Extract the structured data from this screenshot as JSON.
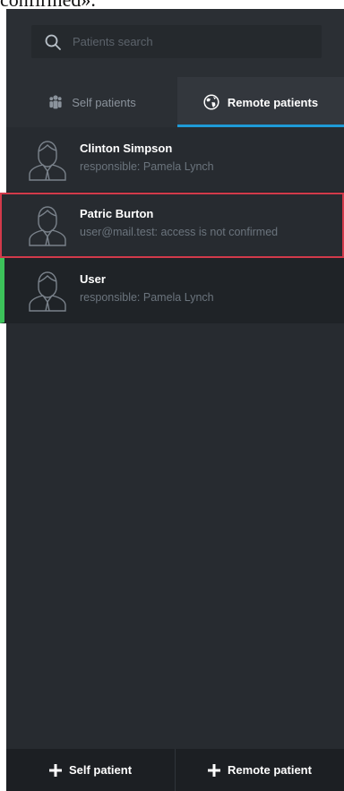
{
  "caption_fragment": "confirmed».",
  "search": {
    "placeholder": "Patients search"
  },
  "tabs": [
    {
      "label": "Self patients",
      "icon": "people-icon",
      "active": false
    },
    {
      "label": "Remote patients",
      "icon": "globe-icon",
      "active": true
    }
  ],
  "patients": [
    {
      "name": "Clinton Simpson",
      "detail": "responsible: Pamela Lynch",
      "state": "normal"
    },
    {
      "name": "Patric Burton",
      "detail": "user@mail.test: access is not confirmed",
      "state": "error"
    },
    {
      "name": "User",
      "detail": "responsible: Pamela Lynch",
      "state": "selected"
    }
  ],
  "footer": {
    "self_label": "Self patient",
    "remote_label": "Remote patient"
  },
  "colors": {
    "panel_bg": "#272b30",
    "accent_blue": "#1e9bd7",
    "error_red": "#d23a4a",
    "selected_green": "#3cc35a"
  }
}
